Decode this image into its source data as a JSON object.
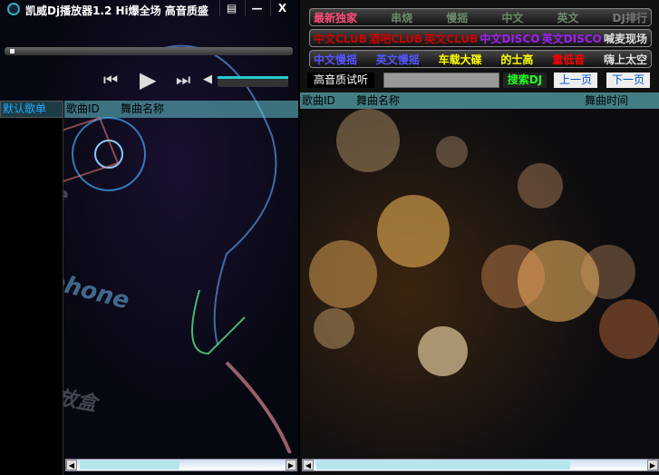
{
  "window": {
    "title": "凯威Dj播放器1.2 Hi爆全场 高音质盛",
    "btn_skin": "▤",
    "btn_min": "—",
    "btn_close": "X"
  },
  "player": {
    "prev": "⏮",
    "play": "▶",
    "next": "⏭",
    "volume_icon": "◀",
    "progress": 0.01,
    "volume": 1.0
  },
  "left": {
    "playlist_tab": "默认歌单",
    "headers": [
      "歌曲ID",
      "舞曲名称"
    ],
    "art": [
      "凯威",
      "Earphone",
      "DJ播放盒"
    ]
  },
  "categories": {
    "row1": [
      {
        "label": "最新独家",
        "color": "#ff4a7a"
      },
      {
        "label": "串烧",
        "color": "#6a8a6a"
      },
      {
        "label": "慢摇",
        "color": "#6a8a6a"
      },
      {
        "label": "中文",
        "color": "#6a8a6a"
      },
      {
        "label": "英文",
        "color": "#6a8a6a"
      },
      {
        "label": "DJ排行",
        "color": "#777"
      }
    ],
    "row2": [
      {
        "label": "中文CLUB",
        "color": "#c00"
      },
      {
        "label": "酒吧CLUB",
        "color": "#c00"
      },
      {
        "label": "英文CLUB",
        "color": "#c00"
      },
      {
        "label": "中文DISCO",
        "color": "#a020f0"
      },
      {
        "label": "英文DISCO",
        "color": "#a020f0"
      },
      {
        "label": "喊麦现场",
        "color": "#ddd"
      }
    ],
    "row3": [
      {
        "label": "中文慢摇",
        "color": "#55f"
      },
      {
        "label": "英文慢摇",
        "color": "#55f"
      },
      {
        "label": "车载大碟",
        "color": "#ff0"
      },
      {
        "label": "的士高",
        "color": "#ff0"
      },
      {
        "label": "重低音",
        "color": "#f00"
      },
      {
        "label": "嗨上太空",
        "color": "#ddd"
      }
    ]
  },
  "search": {
    "quality_label": "高音质试听",
    "value": "",
    "button": "搜索DJ",
    "prev_page": "上一页",
    "next_page": "下一页"
  },
  "right": {
    "headers": [
      "歌曲ID",
      "舞曲名称",
      "舞曲时间"
    ]
  }
}
